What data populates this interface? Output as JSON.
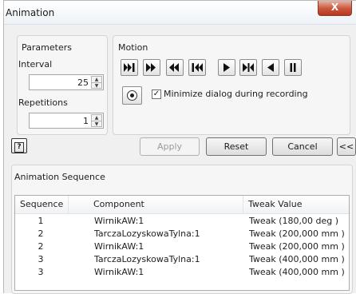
{
  "window": {
    "title": "Animation",
    "close_label": "X"
  },
  "parameters": {
    "group_label": "Parameters",
    "interval_label": "Interval",
    "interval_value": "25",
    "repetitions_label": "Repetitions",
    "repetitions_value": "1"
  },
  "motion": {
    "group_label": "Motion",
    "transport_icons": [
      "skip-to-end-icon",
      "fast-forward-icon",
      "rewind-icon",
      "skip-to-start-icon",
      "play-icon",
      "step-end-icon",
      "play-reverse-icon",
      "pause-icon"
    ],
    "record_icon": "record-icon",
    "minimize_checked": true,
    "minimize_label": "Minimize dialog during recording"
  },
  "buttons": {
    "apply": "Apply",
    "reset": "Reset",
    "cancel": "Cancel",
    "collapse": "<<",
    "help_icon": "help-icon"
  },
  "sequence": {
    "group_label": "Animation Sequence",
    "columns": [
      "Sequence",
      "Component",
      "Tweak Value"
    ],
    "rows": [
      {
        "sequence": "1",
        "component": "WirnikAW:1",
        "tweak": "Tweak (180,00 deg )"
      },
      {
        "sequence": "2",
        "component": "TarczaLozyskowaTylna:1",
        "tweak": "Tweak (200,000 mm )"
      },
      {
        "sequence": "2",
        "component": "WirnikAW:1",
        "tweak": "Tweak (200,000 mm )"
      },
      {
        "sequence": "3",
        "component": "TarczaLozyskowaTylna:1",
        "tweak": "Tweak (400,000 mm )"
      },
      {
        "sequence": "3",
        "component": "WirnikAW:1",
        "tweak": "Tweak (400,000 mm )"
      }
    ]
  }
}
